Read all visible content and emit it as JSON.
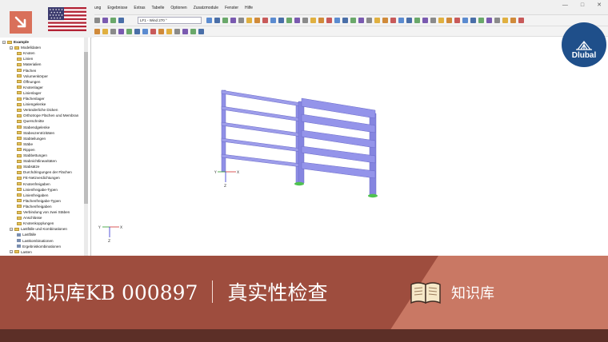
{
  "menu": [
    "ung",
    "Ergebnisse",
    "Extras",
    "Tabelle",
    "Optionen",
    "Zusatzmodule",
    "Fenster",
    "Hilfe"
  ],
  "loadcase_selector": "LF1 - Wind 270 °",
  "window_controls": [
    "—",
    "□",
    "✕"
  ],
  "navigator": {
    "items": [
      {
        "label": "Example",
        "level": 0,
        "kind": "root"
      },
      {
        "label": "Modelldaten",
        "level": 1,
        "kind": "folder"
      },
      {
        "label": "Knoten",
        "level": 2,
        "kind": "folder"
      },
      {
        "label": "Linien",
        "level": 2,
        "kind": "folder"
      },
      {
        "label": "Materialien",
        "level": 2,
        "kind": "folder"
      },
      {
        "label": "Flächen",
        "level": 2,
        "kind": "folder"
      },
      {
        "label": "Volumenkörper",
        "level": 2,
        "kind": "folder"
      },
      {
        "label": "Öffnungen",
        "level": 2,
        "kind": "folder"
      },
      {
        "label": "Knotenlager",
        "level": 2,
        "kind": "folder"
      },
      {
        "label": "Linienlager",
        "level": 2,
        "kind": "folder"
      },
      {
        "label": "Flächenlager",
        "level": 2,
        "kind": "folder"
      },
      {
        "label": "Liniengelenke",
        "level": 2,
        "kind": "folder"
      },
      {
        "label": "Veränderliche Dicken",
        "level": 2,
        "kind": "folder"
      },
      {
        "label": "Orthotrope Flächen und Membran",
        "level": 2,
        "kind": "folder"
      },
      {
        "label": "Querschnitte",
        "level": 2,
        "kind": "folder"
      },
      {
        "label": "Stabendgelenke",
        "level": 2,
        "kind": "folder"
      },
      {
        "label": "Stabexzentrizitäten",
        "level": 2,
        "kind": "folder"
      },
      {
        "label": "Stabteilungen",
        "level": 2,
        "kind": "folder"
      },
      {
        "label": "Stäbe",
        "level": 2,
        "kind": "folder"
      },
      {
        "label": "Rippen",
        "level": 2,
        "kind": "folder"
      },
      {
        "label": "Stabbettungen",
        "level": 2,
        "kind": "folder"
      },
      {
        "label": "Stabnichtlinearitäten",
        "level": 2,
        "kind": "folder"
      },
      {
        "label": "Stabsätze",
        "level": 2,
        "kind": "folder"
      },
      {
        "label": "Durchdringungen der Flächen",
        "level": 2,
        "kind": "folder"
      },
      {
        "label": "FE-Netzverdichtungen",
        "level": 2,
        "kind": "folder"
      },
      {
        "label": "Knotenfreigaben",
        "level": 2,
        "kind": "folder"
      },
      {
        "label": "Linienfreigabe-Typen",
        "level": 2,
        "kind": "folder"
      },
      {
        "label": "Linienfreigaben",
        "level": 2,
        "kind": "folder"
      },
      {
        "label": "Flächenfreigabe-Typen",
        "level": 2,
        "kind": "folder"
      },
      {
        "label": "Flächenfreigaben",
        "level": 2,
        "kind": "folder"
      },
      {
        "label": "Verbindung von zwei Stäben",
        "level": 2,
        "kind": "folder"
      },
      {
        "label": "Anschlüsse",
        "level": 2,
        "kind": "folder"
      },
      {
        "label": "Knotenkopplungen",
        "level": 2,
        "kind": "folder"
      },
      {
        "label": "Lastfälle und Kombinationen",
        "level": 1,
        "kind": "folder"
      },
      {
        "label": "Lastfälle",
        "level": 2,
        "kind": "item"
      },
      {
        "label": "Lastkombinationen",
        "level": 2,
        "kind": "item"
      },
      {
        "label": "Ergebniskombinationen",
        "level": 2,
        "kind": "item"
      },
      {
        "label": "Lasten",
        "level": 1,
        "kind": "folder"
      }
    ]
  },
  "axes": {
    "x": "X",
    "y": "Y",
    "z": "Z"
  },
  "logo": {
    "text": "Dlubal"
  },
  "banner": {
    "title": "知识库KB 000897",
    "subtitle": "真实性检查",
    "kb_label": "知识库"
  },
  "colors": {
    "banner": "#c97864",
    "banner_dark": "#5c2f27",
    "logo": "#1f4f8a",
    "members": "#8f8fe6",
    "support": "#4fc24f"
  }
}
